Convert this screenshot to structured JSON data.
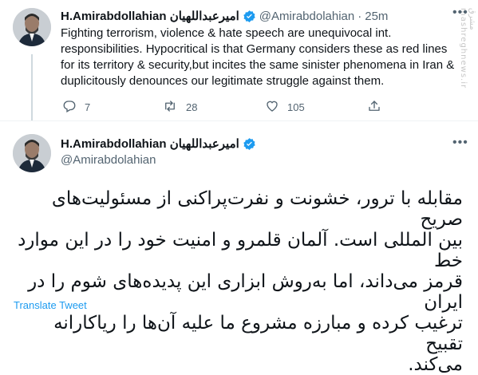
{
  "tweet1": {
    "name": "H.Amirabdollahian امیرعبداللهیان",
    "handle": "@Amirabdolahian",
    "separator": "·",
    "time": "25m",
    "text_lines": [
      "Fighting terrorism, violence & hate speech are unequivocal int.",
      "responsibilities. Hypocritical is that Germany considers these as red lines",
      "for its territory & security,but incites the same sinister phenomena in Iran &",
      "duplicitously denounces our legitimate struggle against them."
    ],
    "replies": "7",
    "retweets": "28",
    "likes": "105"
  },
  "tweet2": {
    "name": "H.Amirabdollahian امیرعبداللهیان",
    "handle": "@Amirabdolahian",
    "text_lines": [
      "مقابله با ترور، خشونت و نفرت‌پراکنی از مسئولیت‌های صریح",
      "بین المللی است. آلمان قلمرو و امنیت خود را در این موارد خط",
      "قرمز می‌داند، اما به‌روش ابزاری این پدیده‌های شوم را در ایران",
      "ترغیب کرده و مبارزه مشروع ما علیه آن‌ها را ریاکارانه تقبیح",
      "می‌کند."
    ],
    "translate": "Translate Tweet"
  },
  "watermark": "مشرق mashreghnews.ir",
  "colors": {
    "verified": "#1d9bf0",
    "muted": "#536471",
    "link": "#1d9bf0"
  },
  "icons": [
    "verified-badge-icon",
    "more-options-icon",
    "reply-icon",
    "retweet-icon",
    "like-icon",
    "share-icon"
  ]
}
